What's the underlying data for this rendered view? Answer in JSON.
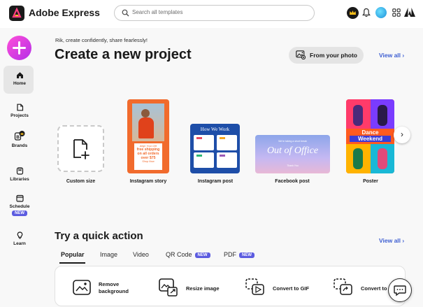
{
  "topbar": {
    "app_name": "Adobe Express",
    "search_placeholder": "Search all templates",
    "icons": [
      "adobe-express-logo",
      "search-icon",
      "crown-icon",
      "bell-icon",
      "avatar",
      "apps-grid-icon",
      "adobe-logo"
    ]
  },
  "sidebar": {
    "create_icon": "plus-icon",
    "items": [
      {
        "label": "Home",
        "icon": "home-icon"
      },
      {
        "label": "Projects",
        "icon": "folder-icon"
      },
      {
        "label": "Brands",
        "icon": "brand-icon"
      },
      {
        "label": "Libraries",
        "icon": "library-icon"
      },
      {
        "label": "Schedule",
        "icon": "calendar-icon",
        "badge": "NEW"
      },
      {
        "label": "Learn",
        "icon": "lightbulb-icon"
      }
    ]
  },
  "hero": {
    "greeting": "Rik, create confidently, share fearlessly!",
    "title": "Create a new project",
    "photo_button": "From your photo",
    "view_all": "View all",
    "templates": [
      {
        "label": "Custom size"
      },
      {
        "label": "Instagram story",
        "promo_top": "Align Your Gift",
        "promo_lines": [
          "free shipping",
          "on all orders",
          "over $75"
        ],
        "promo_bottom": "Shop Now"
      },
      {
        "label": "Instagram post",
        "heading": "How We Work"
      },
      {
        "label": "Facebook post",
        "heading": "Out of Office",
        "subtext": "We're taking a short break",
        "footer": "Thank You"
      },
      {
        "label": "Poster",
        "heading_lines": [
          "Dance",
          "Weekend"
        ]
      }
    ]
  },
  "quick_actions": {
    "title": "Try a quick action",
    "view_all": "View all",
    "tabs": [
      {
        "label": "Popular",
        "active": true
      },
      {
        "label": "Image"
      },
      {
        "label": "Video"
      },
      {
        "label": "QR Code",
        "badge": "NEW"
      },
      {
        "label": "PDF",
        "badge": "NEW"
      }
    ],
    "items": [
      {
        "label_lines": [
          "Remove",
          "background"
        ],
        "icon": "remove-background-icon"
      },
      {
        "label": "Resize image",
        "icon": "resize-image-icon"
      },
      {
        "label": "Convert to GIF",
        "icon": "convert-gif-icon"
      },
      {
        "label": "Convert to",
        "icon": "convert-icon"
      }
    ]
  },
  "colors": {
    "accent": "#3e5fd2",
    "new_badge": "#5c5ce0",
    "create_gradient_start": "#ff4fd8",
    "create_gradient_end": "#b42ee8"
  }
}
